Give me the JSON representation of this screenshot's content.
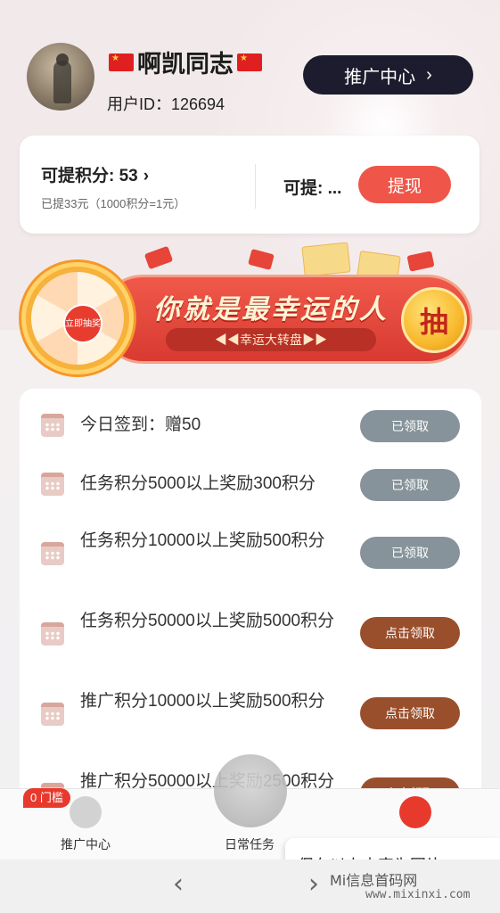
{
  "profile": {
    "name": "啊凯同志",
    "user_id_label": "用户ID：",
    "user_id": "126694",
    "promo_button": "推广中心",
    "chevron": "›"
  },
  "points": {
    "title": "可提积分: 53",
    "chevron": "›",
    "subtitle": "已提33元（1000积分=1元）",
    "withdrawable_label": "可提: ...",
    "withdraw_button": "提现"
  },
  "banner": {
    "title": "你就是最幸运的人",
    "subtitle": "◀◀幸运大转盘▶▶",
    "draw_button": "抽",
    "wheel_center": "立即抽奖"
  },
  "tasks": [
    {
      "label": "今日签到：赠50",
      "button": "已领取",
      "status": "done"
    },
    {
      "label": "任务积分5000以上奖励300积分",
      "button": "已领取",
      "status": "done"
    },
    {
      "label": "任务积分10000以上奖励500积分",
      "button": "已领取",
      "status": "done"
    },
    {
      "label": "任务积分50000以上奖励5000积分",
      "button": "点击领取",
      "status": "claim"
    },
    {
      "label": "推广积分10000以上奖励500积分",
      "button": "点击领取",
      "status": "claim"
    },
    {
      "label": "推广积分50000以上奖励2500积分",
      "button": "点击领取",
      "status": "claim"
    }
  ],
  "tabbar": {
    "badge": "0 门槛",
    "tab_promo": "推广中心",
    "tab_daily": "日常任务"
  },
  "save_banner": "保存以上内容为图片",
  "watermark": {
    "text": "Mi信息首码网",
    "url": "www.mixinxi.com"
  },
  "colors": {
    "accent_red": "#ef5548",
    "dark_button": "#1c1c2e",
    "done_gray": "#86939a",
    "claim_brown": "#9a4f2c"
  }
}
